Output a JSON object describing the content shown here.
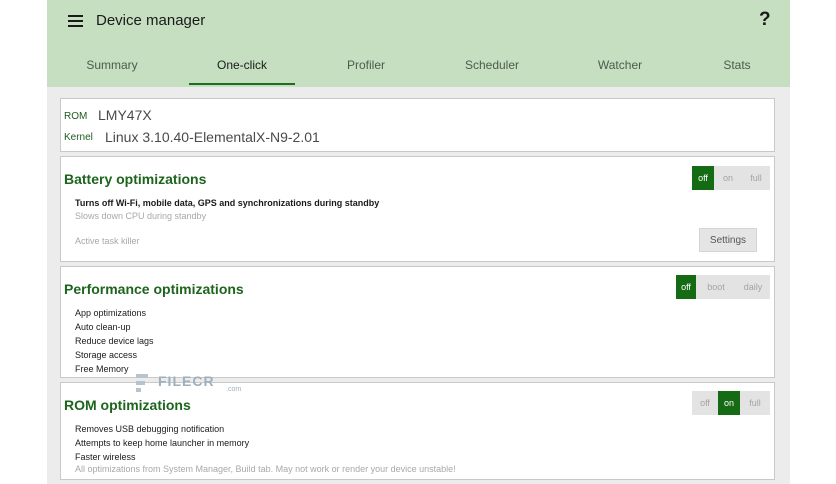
{
  "header": {
    "title": "Device manager",
    "help_label": "?",
    "menu_icon": "hamburger-menu-icon"
  },
  "tabs": [
    {
      "label": "Summary"
    },
    {
      "label": "One-click",
      "active": true
    },
    {
      "label": "Profiler"
    },
    {
      "label": "Scheduler"
    },
    {
      "label": "Watcher"
    },
    {
      "label": "Stats"
    }
  ],
  "info": {
    "rom_label": "ROM",
    "rom_value": "LMY47X",
    "kernel_label": "Kernel",
    "kernel_value": "Linux 3.10.40-ElementalX-N9-2.01"
  },
  "battery": {
    "title": "Battery optimizations",
    "options": [
      "off",
      "on",
      "full"
    ],
    "selected": "off",
    "desc": "Turns off Wi-Fi, mobile data, GPS and synchronizations during standby",
    "desc_sub": "Slows down CPU during standby",
    "task_killer": "Active task killer",
    "settings_label": "Settings"
  },
  "performance": {
    "title": "Performance optimizations",
    "options": [
      "off",
      "boot",
      "daily"
    ],
    "selected": "off",
    "items": [
      "App optimizations",
      "Auto clean-up",
      "Reduce device lags",
      "Storage access",
      "Free Memory"
    ]
  },
  "rom": {
    "title": "ROM optimizations",
    "options": [
      "off",
      "on",
      "full"
    ],
    "selected": "on",
    "items": [
      "Removes USB debugging notification",
      "Attempts to keep home launcher in memory",
      "Faster wireless"
    ],
    "note": "All optimizations from System Manager, Build tab. May not work or render your device unstable!"
  },
  "watermark": {
    "text": "FILECR",
    "sub": ".com",
    "icon": "filecr-logo-icon"
  },
  "colors": {
    "appbar": "#c6dfc0",
    "accent": "#1d641d",
    "toggle_on": "#146b14",
    "background": "#ececec"
  }
}
